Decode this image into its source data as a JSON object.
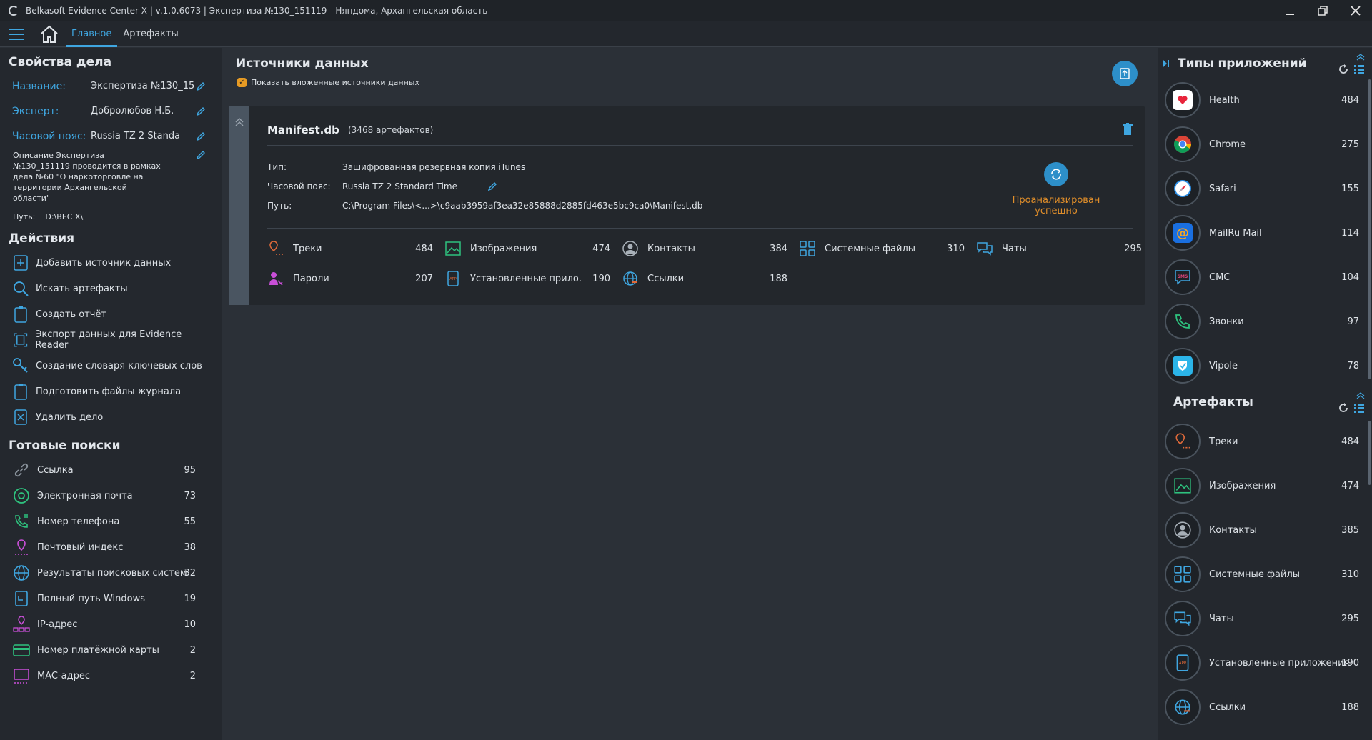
{
  "window": {
    "title": "Belkasoft Evidence Center X | v.1.0.6073 | Экспертиза №130_151119 - Няндома, Архангельская область"
  },
  "menu": {
    "tabs": [
      {
        "label": "Главное",
        "active": true
      },
      {
        "label": "Артефакты",
        "active": false
      }
    ]
  },
  "case": {
    "section_title": "Свойства дела",
    "name_label": "Название:",
    "name_value": "Экспертиза №130_15",
    "expert_label": "Эксперт:",
    "expert_value": "Добролюбов Н.Б.",
    "tz_label": "Часовой пояс:",
    "tz_value": "Russia TZ 2 Standa",
    "description": "Описание Экспертиза №130_151119 проводится в рамках дела №60 \"О наркоторговле на территории Архангельской области\"",
    "path_label": "Путь:",
    "path_value": "D:\\BEC X\\"
  },
  "actions": {
    "section_title": "Действия",
    "items": [
      {
        "label": "Добавить источник данных",
        "icon": "add-source-icon"
      },
      {
        "label": "Искать артефакты",
        "icon": "search-icon"
      },
      {
        "label": "Создать отчёт",
        "icon": "report-icon"
      },
      {
        "label": "Экспорт данных для Evidence Reader",
        "icon": "export-icon"
      },
      {
        "label": "Создание словаря ключевых слов",
        "icon": "key-icon"
      },
      {
        "label": "Подготовить файлы журнала",
        "icon": "log-icon"
      },
      {
        "label": "Удалить дело",
        "icon": "delete-case-icon"
      }
    ]
  },
  "searches": {
    "section_title": "Готовые поиски",
    "items": [
      {
        "label": "Ссылка",
        "count": "95",
        "icon": "link-icon"
      },
      {
        "label": "Электронная почта",
        "count": "73",
        "icon": "email-icon"
      },
      {
        "label": "Номер телефона",
        "count": "55",
        "icon": "phone-icon"
      },
      {
        "label": "Почтовый индекс",
        "count": "38",
        "icon": "postal-icon"
      },
      {
        "label": "Результаты поисковых систем",
        "count": "32",
        "icon": "globe-icon"
      },
      {
        "label": "Полный путь Windows",
        "count": "19",
        "icon": "path-icon"
      },
      {
        "label": "IP-адрес",
        "count": "10",
        "icon": "ip-icon"
      },
      {
        "label": "Номер платёжной карты",
        "count": "2",
        "icon": "card-icon"
      },
      {
        "label": "MAC-адрес",
        "count": "2",
        "icon": "mac-icon"
      }
    ]
  },
  "sources": {
    "title": "Источники данных",
    "show_nested_label": "Показать вложенные источники данных",
    "show_nested_checked": true,
    "card": {
      "name": "Manifest.db",
      "count": "(3468 артефактов)",
      "type_label": "Тип:",
      "type_value": "Зашифрованная резервная копия iTunes",
      "tz_label": "Часовой пояс:",
      "tz_value": "Russia TZ 2 Standard Time",
      "path_label": "Путь:",
      "path_value": "C:\\Program Files\\<...>\\c9aab3959af3ea32e85888d2885fd463e5bc9ca0\\Manifest.db",
      "status": "Проанализирован успешно",
      "artifacts": [
        {
          "label": "Треки",
          "value": "484",
          "icon": "track-icon"
        },
        {
          "label": "Изображения",
          "value": "474",
          "icon": "image-icon"
        },
        {
          "label": "Контакты",
          "value": "384",
          "icon": "contact-icon"
        },
        {
          "label": "Системные файлы",
          "value": "310",
          "icon": "system-files-icon"
        },
        {
          "label": "Чаты",
          "value": "295",
          "icon": "chat-icon"
        },
        {
          "label": "Пароли",
          "value": "207",
          "icon": "password-icon"
        },
        {
          "label": "Установленные прило...",
          "value": "190",
          "icon": "app-icon"
        },
        {
          "label": "Ссылки",
          "value": "188",
          "icon": "links-icon"
        }
      ]
    }
  },
  "app_types": {
    "title": "Типы приложений",
    "items": [
      {
        "label": "Health",
        "value": "484",
        "icon": "health-icon"
      },
      {
        "label": "Chrome",
        "value": "275",
        "icon": "chrome-icon"
      },
      {
        "label": "Safari",
        "value": "155",
        "icon": "safari-icon"
      },
      {
        "label": "MailRu Mail",
        "value": "114",
        "icon": "mailru-icon"
      },
      {
        "label": "СМС",
        "value": "104",
        "icon": "sms-icon"
      },
      {
        "label": "Звонки",
        "value": "97",
        "icon": "calls-icon"
      },
      {
        "label": "Vipole",
        "value": "78",
        "icon": "vipole-icon"
      }
    ]
  },
  "artifacts_panel": {
    "title": "Артефакты",
    "items": [
      {
        "label": "Треки",
        "value": "484",
        "icon": "track-icon"
      },
      {
        "label": "Изображения",
        "value": "474",
        "icon": "image-icon"
      },
      {
        "label": "Контакты",
        "value": "385",
        "icon": "contact-icon"
      },
      {
        "label": "Системные файлы",
        "value": "310",
        "icon": "system-files-icon"
      },
      {
        "label": "Чаты",
        "value": "295",
        "icon": "chat-icon"
      },
      {
        "label": "Установленные приложения",
        "value": "190",
        "icon": "app-icon"
      },
      {
        "label": "Ссылки",
        "value": "188",
        "icon": "links-icon"
      }
    ]
  }
}
